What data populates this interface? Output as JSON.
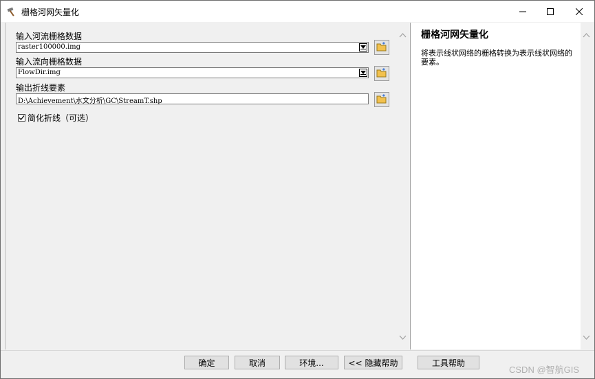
{
  "window": {
    "title": "栅格河网矢量化"
  },
  "form": {
    "stream_raster_label": "输入河流栅格数据",
    "stream_raster_value": "raster100000.img",
    "flow_dir_label": "输入流向栅格数据",
    "flow_dir_value": "FlowDir.img",
    "output_label": "输出折线要素",
    "output_value": "D:\\Achievement\\水文分析\\GC\\StreamT.shp",
    "simplify_label": "简化折线（可选）",
    "simplify_checked": true
  },
  "help": {
    "title": "栅格河网矢量化",
    "body": "将表示线状网络的栅格转换为表示线状网络的要素。"
  },
  "buttons": {
    "ok": "确定",
    "cancel": "取消",
    "env": "环境...",
    "hide_help": "<< 隐藏帮助",
    "tool_help": "工具帮助"
  },
  "watermark": "CSDN @智航GIS"
}
